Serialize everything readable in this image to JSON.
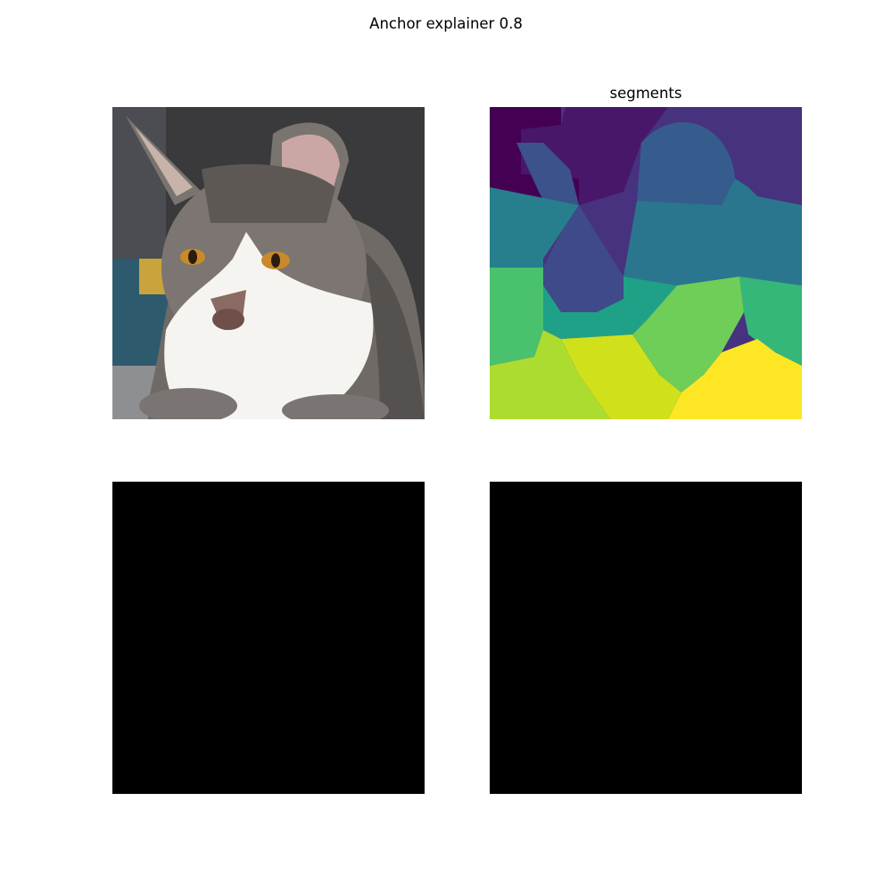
{
  "figure": {
    "suptitle": "Anchor explainer 0.8",
    "panels": [
      {
        "title": ""
      },
      {
        "title": "segments"
      },
      {
        "title": ""
      },
      {
        "title": ""
      }
    ]
  },
  "colors": {
    "background": "#ffffff",
    "masked": "#000000",
    "viridis_segments": [
      "#440154",
      "#46327e",
      "#365c8d",
      "#277f8e",
      "#1fa187",
      "#4ac16d",
      "#a0da39",
      "#fde725"
    ]
  }
}
